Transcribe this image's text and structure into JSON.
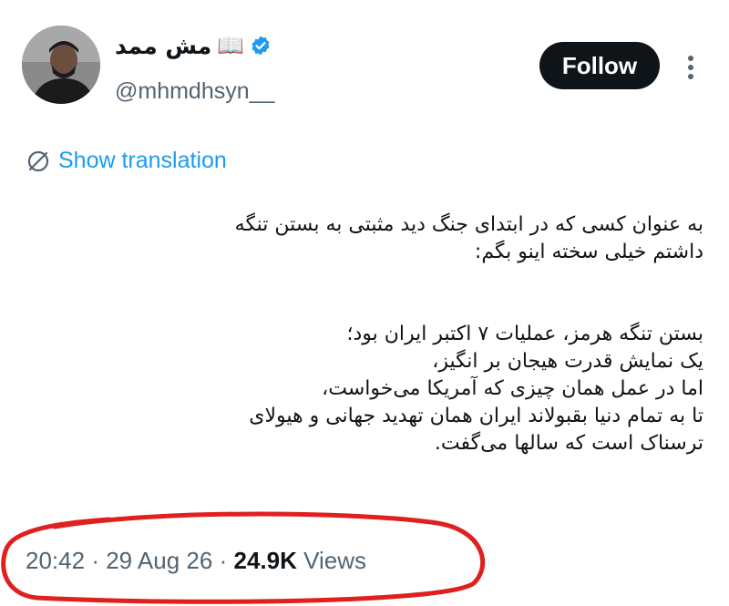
{
  "author": {
    "display_name": "مش ممد",
    "display_emoji": "📖",
    "handle": "@mhmdhsyn__",
    "verified": true
  },
  "actions": {
    "follow_label": "Follow"
  },
  "translation": {
    "label": "Show translation"
  },
  "tweet": {
    "paragraph1": "به عنوان کسی که در ابتدای جنگ دید مثبتی به بستن تنگه\nداشتم خیلی سخته اینو بگم:",
    "paragraph2": "بستن تنگه هرمز، عملیات ۷ اکتبر ایران بود؛\nیک نمایش قدرت هیجان بر انگیز،\nاما در عمل همان چیزی که آمریکا می‌خواست،\nتا به تمام دنیا بقبولاند ایران همان تهدید جهانی و هیولای\nترسناک است که سالها می‌گفت."
  },
  "meta": {
    "time": "20:42",
    "separator": "·",
    "date": "29 Aug 26",
    "views_count": "24.9K",
    "views_label": "Views"
  },
  "colors": {
    "accent": "#1d9bf0",
    "text": "#0f1419",
    "muted": "#536471",
    "annotation": "#e0201f"
  },
  "icons": {
    "verified": "verified-badge-icon",
    "translate": "translate-globe-icon",
    "more": "more-vertical-icon"
  }
}
